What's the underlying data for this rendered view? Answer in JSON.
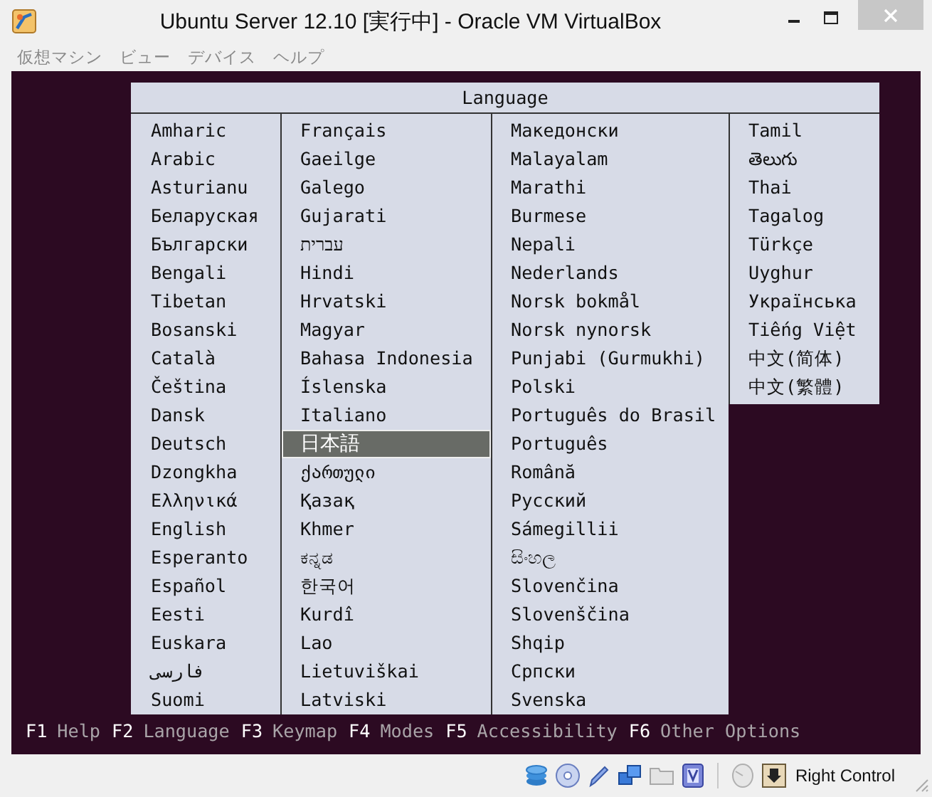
{
  "window": {
    "title": "Ubuntu Server 12.10 [実行中] - Oracle VM VirtualBox"
  },
  "menu": [
    "仮想マシン",
    "ビュー",
    "デバイス",
    "ヘルプ"
  ],
  "dialog": {
    "title": "Language",
    "columns": [
      {
        "items": [
          {
            "label": "Amharic",
            "selected": false
          },
          {
            "label": "Arabic",
            "selected": false
          },
          {
            "label": "Asturianu",
            "selected": false
          },
          {
            "label": "Беларуская",
            "selected": false
          },
          {
            "label": "Български",
            "selected": false
          },
          {
            "label": "Bengali",
            "selected": false
          },
          {
            "label": "Tibetan",
            "selected": false
          },
          {
            "label": "Bosanski",
            "selected": false
          },
          {
            "label": "Català",
            "selected": false
          },
          {
            "label": "Čeština",
            "selected": false
          },
          {
            "label": "Dansk",
            "selected": false
          },
          {
            "label": "Deutsch",
            "selected": false
          },
          {
            "label": "Dzongkha",
            "selected": false
          },
          {
            "label": "Ελληνικά",
            "selected": false
          },
          {
            "label": "English",
            "selected": false
          },
          {
            "label": "Esperanto",
            "selected": false
          },
          {
            "label": "Español",
            "selected": false
          },
          {
            "label": "Eesti",
            "selected": false
          },
          {
            "label": "Euskara",
            "selected": false
          },
          {
            "label": "فارسی",
            "selected": false
          },
          {
            "label": "Suomi",
            "selected": false
          }
        ]
      },
      {
        "items": [
          {
            "label": "Français",
            "selected": false
          },
          {
            "label": "Gaeilge",
            "selected": false
          },
          {
            "label": "Galego",
            "selected": false
          },
          {
            "label": "Gujarati",
            "selected": false
          },
          {
            "label": "עברית",
            "selected": false
          },
          {
            "label": "Hindi",
            "selected": false
          },
          {
            "label": "Hrvatski",
            "selected": false
          },
          {
            "label": "Magyar",
            "selected": false
          },
          {
            "label": "Bahasa Indonesia",
            "selected": false
          },
          {
            "label": "Íslenska",
            "selected": false
          },
          {
            "label": "Italiano",
            "selected": false
          },
          {
            "label": "日本語",
            "selected": true
          },
          {
            "label": "ქართული",
            "selected": false
          },
          {
            "label": "Қазақ",
            "selected": false
          },
          {
            "label": "Khmer",
            "selected": false
          },
          {
            "label": "ಕನ್ನಡ",
            "selected": false
          },
          {
            "label": "한국어",
            "selected": false
          },
          {
            "label": "Kurdî",
            "selected": false
          },
          {
            "label": "Lao",
            "selected": false
          },
          {
            "label": "Lietuviškai",
            "selected": false
          },
          {
            "label": "Latviski",
            "selected": false
          }
        ]
      },
      {
        "items": [
          {
            "label": "Македонски",
            "selected": false
          },
          {
            "label": "Malayalam",
            "selected": false
          },
          {
            "label": "Marathi",
            "selected": false
          },
          {
            "label": "Burmese",
            "selected": false
          },
          {
            "label": "Nepali",
            "selected": false
          },
          {
            "label": "Nederlands",
            "selected": false
          },
          {
            "label": "Norsk bokmål",
            "selected": false
          },
          {
            "label": "Norsk nynorsk",
            "selected": false
          },
          {
            "label": "Punjabi (Gurmukhi)",
            "selected": false
          },
          {
            "label": "Polski",
            "selected": false
          },
          {
            "label": "Português do Brasil",
            "selected": false
          },
          {
            "label": "Português",
            "selected": false
          },
          {
            "label": "Română",
            "selected": false
          },
          {
            "label": "Русский",
            "selected": false
          },
          {
            "label": "Sámegillii",
            "selected": false
          },
          {
            "label": "සිංහල",
            "selected": false
          },
          {
            "label": "Slovenčina",
            "selected": false
          },
          {
            "label": "Slovenščina",
            "selected": false
          },
          {
            "label": "Shqip",
            "selected": false
          },
          {
            "label": "Српски",
            "selected": false
          },
          {
            "label": "Svenska",
            "selected": false
          }
        ]
      },
      {
        "items": [
          {
            "label": "Tamil",
            "selected": false
          },
          {
            "label": "తెలుగు",
            "selected": false
          },
          {
            "label": "Thai",
            "selected": false
          },
          {
            "label": "Tagalog",
            "selected": false
          },
          {
            "label": "Türkçe",
            "selected": false
          },
          {
            "label": "Uyghur",
            "selected": false
          },
          {
            "label": "Українська",
            "selected": false
          },
          {
            "label": "Tiếng Việt",
            "selected": false
          },
          {
            "label": "中文(简体)",
            "selected": false
          },
          {
            "label": "中文(繁體)",
            "selected": false
          }
        ]
      }
    ]
  },
  "function_keys": [
    {
      "key": "F1",
      "label": "Help"
    },
    {
      "key": "F2",
      "label": "Language"
    },
    {
      "key": "F3",
      "label": "Keymap"
    },
    {
      "key": "F4",
      "label": "Modes"
    },
    {
      "key": "F5",
      "label": "Accessibility"
    },
    {
      "key": "F6",
      "label": "Other Options"
    }
  ],
  "status_bar": {
    "host_key": "Right Control"
  }
}
